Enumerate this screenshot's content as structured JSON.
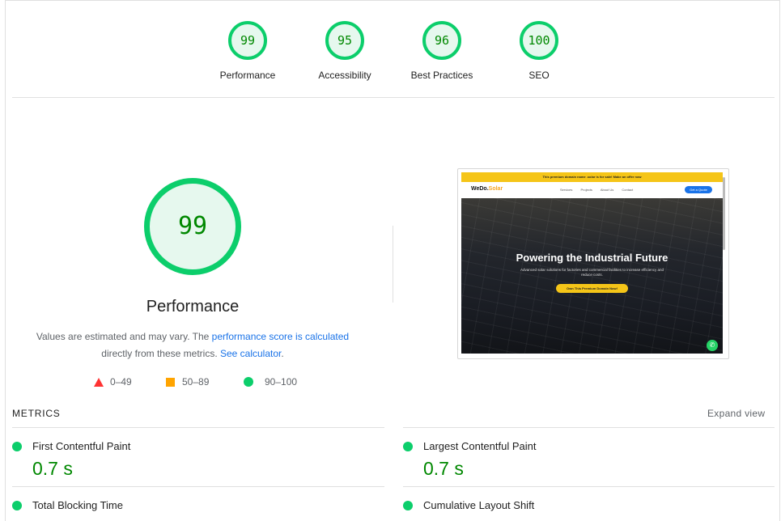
{
  "categories": [
    {
      "score": "99",
      "label": "Performance"
    },
    {
      "score": "95",
      "label": "Accessibility"
    },
    {
      "score": "96",
      "label": "Best Practices"
    },
    {
      "score": "100",
      "label": "SEO"
    }
  ],
  "main": {
    "score": "99",
    "title": "Performance",
    "desc_part1": "Values are estimated and may vary. The ",
    "desc_link1": "performance score is calculated",
    "desc_part2": "directly from these metrics. ",
    "desc_link2": "See calculator",
    "desc_part3": "."
  },
  "legend": {
    "fail": "0–49",
    "average": "50–89",
    "pass": "90–100"
  },
  "colors": {
    "pass": "#0cce6b",
    "average": "#ffa400",
    "fail": "#ff3333",
    "link": "#1a73e8"
  },
  "thumbnail": {
    "banner": "This premium domain name .solar is for sale! Make an offer now",
    "brand_prefix": "WeDo.",
    "brand_suffix": "Solar",
    "nav": [
      "Services",
      "Projects",
      "About Us",
      "Contact"
    ],
    "cta": "Get a Quote",
    "hero_title": "Powering the Industrial Future",
    "hero_sub": "Advanced solar solutions for factories and commercial facilities to increase efficiency and reduce costs.",
    "hero_button": "Own This Premium Domain Now!",
    "whatsapp_icon": "whatsapp-icon"
  },
  "metrics": {
    "header": "METRICS",
    "expand": "Expand view",
    "items": [
      {
        "name": "First Contentful Paint",
        "value": "0.7 s"
      },
      {
        "name": "Largest Contentful Paint",
        "value": "0.7 s"
      },
      {
        "name": "Total Blocking Time",
        "value": ""
      },
      {
        "name": "Cumulative Layout Shift",
        "value": ""
      }
    ]
  }
}
